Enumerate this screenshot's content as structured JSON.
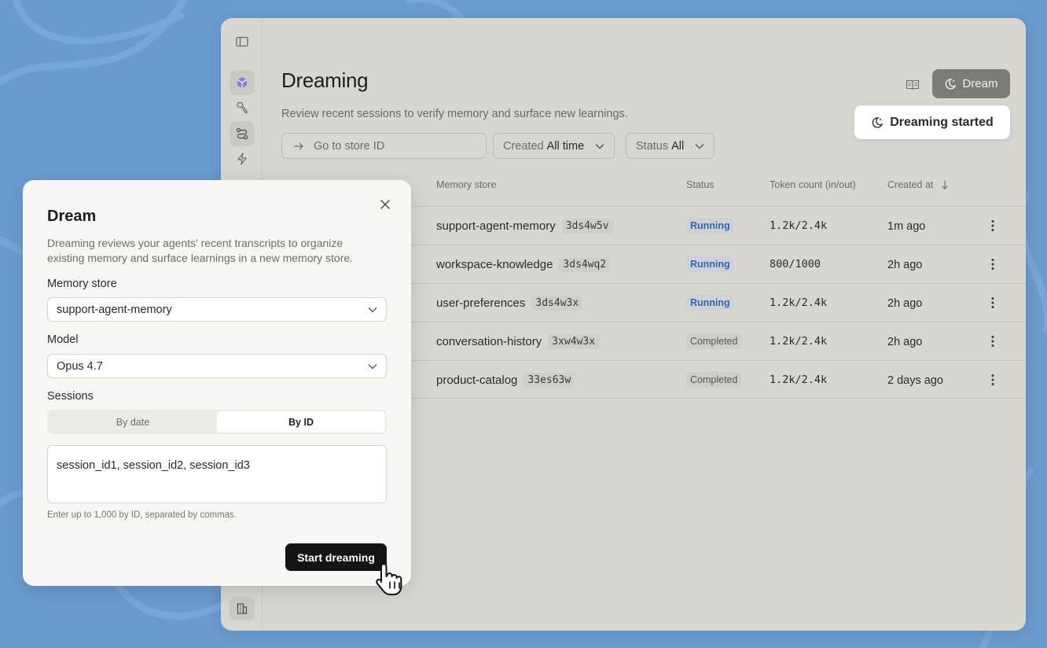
{
  "page": {
    "title": "Dreaming",
    "subtitle": "Review recent sessions to verify memory and surface new learnings.",
    "dream_button": "Dream",
    "toast": "Dreaming started",
    "goto_placeholder": "Go to store ID",
    "filters": [
      {
        "label": "Created",
        "value": "All time"
      },
      {
        "label": "Status",
        "value": "All"
      }
    ]
  },
  "table": {
    "headers": {
      "memory_store": "Memory store",
      "status": "Status",
      "tokens": "Token count (in/out)",
      "created": "Created at"
    },
    "rows": [
      {
        "name": "support-agent-memory",
        "id": "3ds4w5v",
        "status": "Running",
        "tokens": "1.2k/2.4k",
        "created": "1m ago"
      },
      {
        "name": "workspace-knowledge",
        "id": "3ds4wq2",
        "status": "Running",
        "tokens": "800/1000",
        "created": "2h ago"
      },
      {
        "name": "user-preferences",
        "id": "3ds4w3x",
        "status": "Running",
        "tokens": "1.2k/2.4k",
        "created": "2h ago"
      },
      {
        "name": "conversation-history",
        "id": "3xw4w3x",
        "status": "Completed",
        "tokens": "1.2k/2.4k",
        "created": "2h ago"
      },
      {
        "name": "product-catalog",
        "id": "33es63w",
        "status": "Completed",
        "tokens": "1.2k/2.4k",
        "created": "2 days ago"
      }
    ]
  },
  "dialog": {
    "title": "Dream",
    "description": "Dreaming reviews your agents' recent transcripts to organize existing memory and surface learnings in a new memory store.",
    "memory_store_label": "Memory store",
    "memory_store_value": "support-agent-memory",
    "model_label": "Model",
    "model_value": "Opus 4.7",
    "sessions_label": "Sessions",
    "segments": [
      "By date",
      "By ID"
    ],
    "selected_segment": "By ID",
    "sessions_value": "session_id1, session_id2, session_id3",
    "hint": "Enter up to 1,000 by ID, separated by commas.",
    "submit": "Start dreaming"
  },
  "colors": {
    "background": "#6a9bd0",
    "running_text": "#3564a8",
    "primary_button": "#141412"
  },
  "icons": [
    "sidebar-toggle-icon",
    "cube-icon",
    "wrench-icon",
    "route-icon",
    "lightning-icon",
    "building-icon",
    "book-icon",
    "moon-icon",
    "arrow-right-icon",
    "chevron-down-icon",
    "arrow-down-icon",
    "kebab-icon",
    "close-icon",
    "hand-cursor-icon"
  ]
}
